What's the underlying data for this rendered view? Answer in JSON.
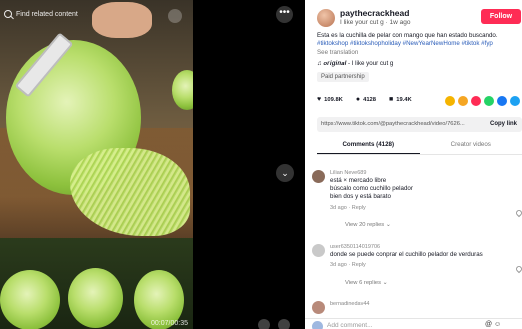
{
  "video": {
    "search_placeholder": "Find related content",
    "time": "00:07/00:35",
    "more_label": "•••",
    "next_label": "⌄"
  },
  "author": {
    "handle": "paythecrackhead",
    "subline": "I like your cut g · 1w ago",
    "follow_label": "Follow"
  },
  "description": {
    "text": "Esta es la cuchilla de pelar con mango que han estado buscando.",
    "hashtags": "#tiktokshop #tiktokshopholiday #NewYearNewHome #tiktok #fyp",
    "see_translation": "See translation",
    "music": "♫ 𝒐𝒓𝒊𝒈𝒊𝒏𝒂𝒍 - I like your cut g",
    "partnership": "Paid partnership"
  },
  "actions": {
    "likes": "109.8K",
    "comments": "4128",
    "saves": "19.4K"
  },
  "share_colors": [
    "#f5b400",
    "#f5a623",
    "#ff2c55",
    "#25d366",
    "#1877f2",
    "#1da1f2"
  ],
  "link": {
    "url": "https://www.tiktok.com/@paythecrackhead/video/7626...",
    "copy_label": "Copy link"
  },
  "tabs": {
    "comments": "Comments (4128)",
    "creator_videos": "Creator videos"
  },
  "comments": [
    {
      "user": "Lilian Neve689",
      "text": "está × mercado libre\nbúscalo como cuchillo pelador\nbien dos y está barato",
      "time": "3d ago",
      "reply": "Reply",
      "view_replies": "View 20 replies ⌄",
      "avatar_color": "#8a6b5a"
    },
    {
      "user": "user6350114019706",
      "text": "donde se puede conprar el cuchillo pelador de verduras",
      "time": "3d ago",
      "reply": "Reply",
      "view_replies": "View 6 replies ⌄",
      "avatar_color": "#c9c9c9"
    },
    {
      "user": "bernadinedav44",
      "text": "",
      "avatar_color": "#b88a7a"
    }
  ],
  "comment_bar": {
    "placeholder": "Add comment...",
    "icons": "@ ☺"
  }
}
